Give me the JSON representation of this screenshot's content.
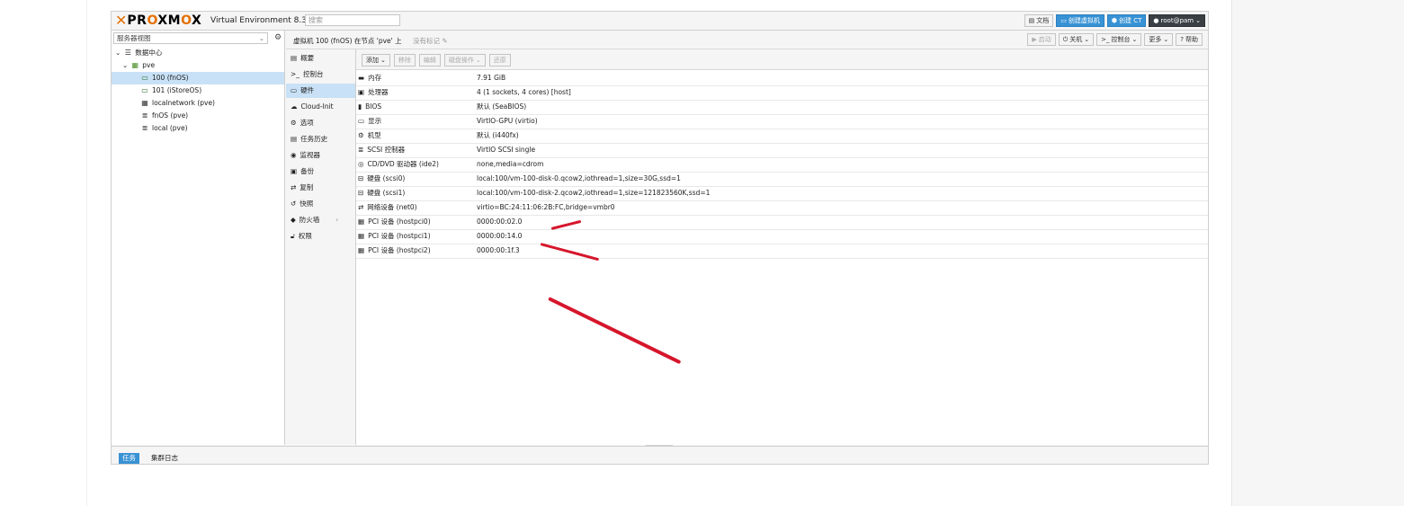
{
  "header": {
    "brand": "PROXMOX",
    "version_label": "Virtual Environment 8.3.2",
    "search_placeholder": "搜索",
    "buttons": {
      "docs": "文档",
      "create_vm": "创建虚拟机",
      "create_ct": "创建 CT",
      "user": "root@pam"
    }
  },
  "tree": {
    "view": "服务器视图",
    "nodes": [
      {
        "label": "数据中心",
        "icon": "datacenter-icon"
      },
      {
        "label": "pve",
        "icon": "node-icon"
      },
      {
        "label": "100 (fnOS)",
        "icon": "vm-running-icon"
      },
      {
        "label": "101 (iStoreOS)",
        "icon": "vm-running-icon"
      },
      {
        "label": "localnetwork (pve)",
        "icon": "network-grid-icon"
      },
      {
        "label": "fnOS (pve)",
        "icon": "storage-icon"
      },
      {
        "label": "local (pve)",
        "icon": "storage-icon"
      }
    ]
  },
  "breadcrumb": {
    "text": "虚拟机 100 (fnOS) 在节点 'pve' 上",
    "tags": "没有标记",
    "actions": {
      "start": "启动",
      "shutdown": "关机",
      "console": "控制台",
      "more": "更多",
      "help": "帮助"
    }
  },
  "menu": {
    "items": [
      "概要",
      "控制台",
      "硬件",
      "Cloud-Init",
      "选项",
      "任务历史",
      "监视器",
      "备份",
      "复制",
      "快照",
      "防火墙",
      "权限"
    ]
  },
  "toolbar": {
    "add": "添加",
    "remove": "移除",
    "edit": "编辑",
    "disk_action": "磁盘操作",
    "revert": "还原"
  },
  "hardware": [
    {
      "key": "内存",
      "value": "7.91 GiB"
    },
    {
      "key": "处理器",
      "value": "4 (1 sockets, 4 cores) [host]"
    },
    {
      "key": "BIOS",
      "value": "默认 (SeaBIOS)"
    },
    {
      "key": "显示",
      "value": "VirtIO-GPU (virtio)"
    },
    {
      "key": "机型",
      "value": "默认 (i440fx)"
    },
    {
      "key": "SCSI 控制器",
      "value": "VirtIO SCSI single"
    },
    {
      "key": "CD/DVD 驱动器 (ide2)",
      "value": "none,media=cdrom"
    },
    {
      "key": "硬盘 (scsi0)",
      "value": "local:100/vm-100-disk-0.qcow2,iothread=1,size=30G,ssd=1"
    },
    {
      "key": "硬盘 (scsi1)",
      "value": "local:100/vm-100-disk-2.qcow2,iothread=1,size=121823560K,ssd=1"
    },
    {
      "key": "网络设备 (net0)",
      "value": "virtio=BC:24:11:06:2B:FC,bridge=vmbr0"
    },
    {
      "key": "PCI 设备 (hostpci0)",
      "value": "0000:00:02.0"
    },
    {
      "key": "PCI 设备 (hostpci1)",
      "value": "0000:00:14.0"
    },
    {
      "key": "PCI 设备 (hostpci2)",
      "value": "0000:00:1f.3"
    }
  ],
  "bottom_tabs": [
    "任务",
    "集群日志"
  ],
  "colors": {
    "accent": "#3892d4",
    "brand_orange": "#e57000",
    "selection": "#c8e1f6",
    "annotation_red": "#d6162c"
  }
}
